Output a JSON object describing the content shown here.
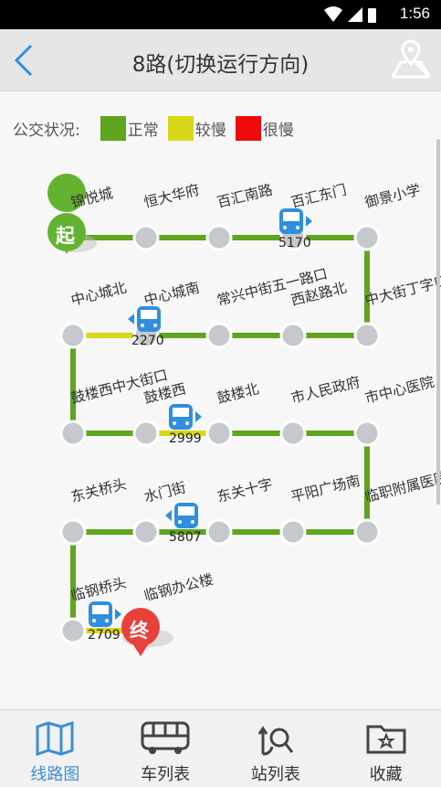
{
  "status_bar": {
    "time": "1:56"
  },
  "header": {
    "title": "8路(切换运行方向)"
  },
  "legend": {
    "label": "公交状况:",
    "items": [
      {
        "color": "#5fa51d",
        "label": "正常"
      },
      {
        "color": "#d8d818",
        "label": "较慢"
      },
      {
        "color": "#ee0a0a",
        "label": "很慢"
      }
    ]
  },
  "route": {
    "start_badge": "起",
    "end_badge": "终",
    "stops": [
      "锦悦城",
      "恒大华府",
      "百汇南路",
      "百汇东门",
      "御景小学",
      "中大街丁字口",
      "西赵路北",
      "常兴中街五一路口",
      "中心城南",
      "中心城北",
      "鼓楼西中大街口",
      "鼓楼西",
      "鼓楼北",
      "市人民政府",
      "市中心医院",
      "临职附属医院",
      "平阳广场南",
      "东关十字",
      "水门街",
      "东关桥头",
      "临钢桥头",
      "临钢办公楼"
    ],
    "buses": [
      {
        "id": "5170",
        "direction": "right"
      },
      {
        "id": "2270",
        "direction": "left"
      },
      {
        "id": "2999",
        "direction": "right"
      },
      {
        "id": "5807",
        "direction": "left"
      },
      {
        "id": "2709",
        "direction": "right"
      }
    ]
  },
  "bottom_nav": {
    "items": [
      {
        "label": "线路图",
        "icon": "map-icon",
        "active": true
      },
      {
        "label": "车列表",
        "icon": "bus-icon",
        "active": false
      },
      {
        "label": "站列表",
        "icon": "stop-search-icon",
        "active": false
      },
      {
        "label": "收藏",
        "icon": "favorite-folder-icon",
        "active": false
      }
    ]
  }
}
